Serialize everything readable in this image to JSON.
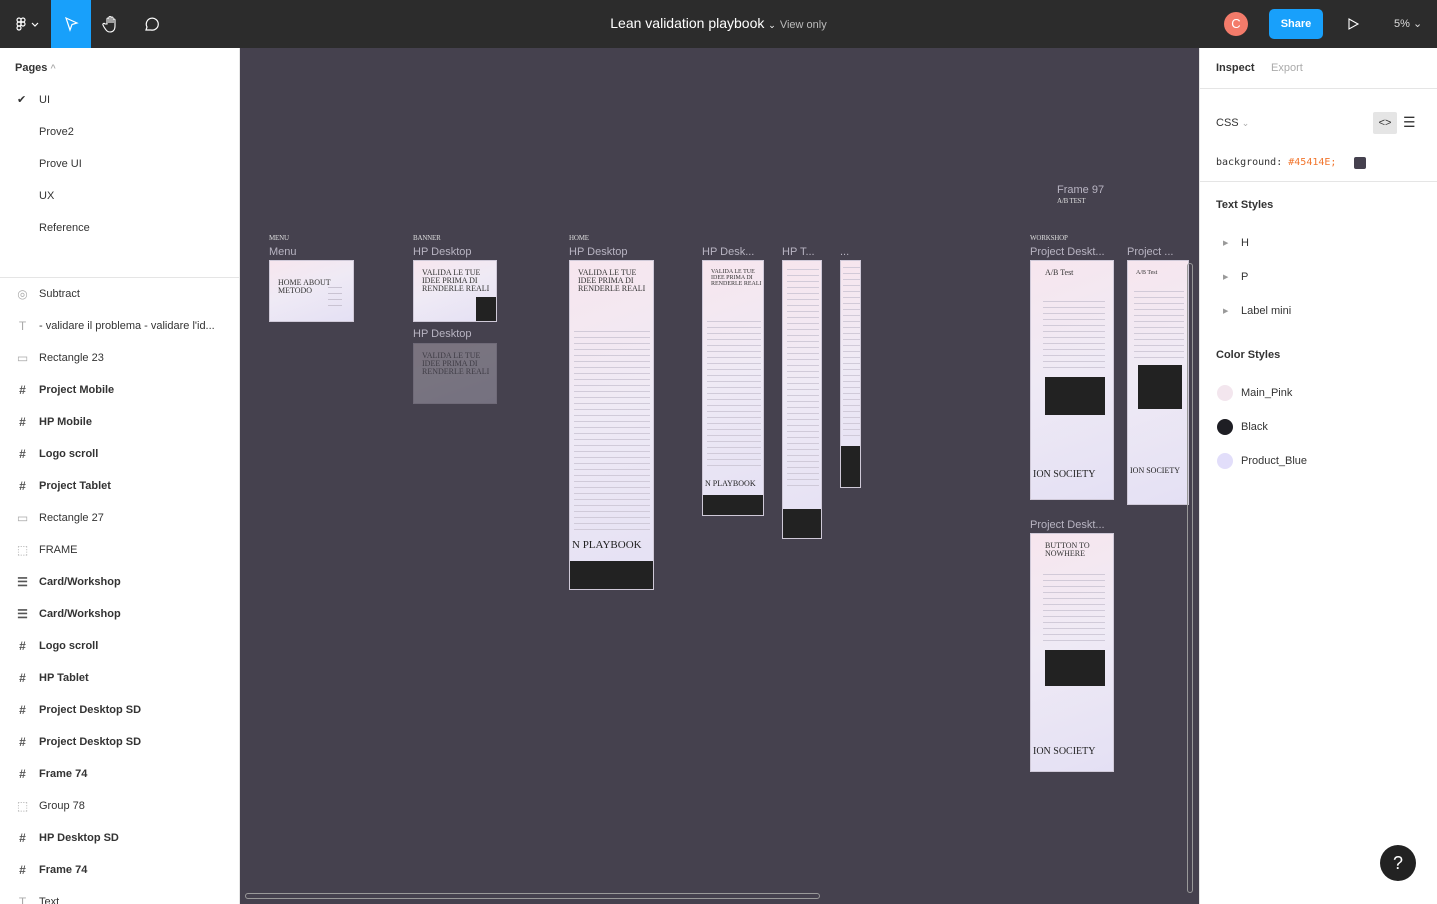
{
  "topbar": {
    "title": "Lean validation playbook",
    "view_mode": "View only",
    "avatar_initial": "C",
    "share_label": "Share",
    "zoom": "5%",
    "accent": "#18a0fb"
  },
  "pages": {
    "header": "Pages",
    "items": [
      {
        "label": "UI",
        "selected": true
      },
      {
        "label": "Prove2"
      },
      {
        "label": "Prove UI"
      },
      {
        "label": "UX"
      },
      {
        "label": "Reference"
      }
    ]
  },
  "layers": [
    {
      "label": "Subtract",
      "icon": "subtract-icon",
      "bold": false
    },
    {
      "label": "- validare il problema - validare l'id...",
      "icon": "text-icon",
      "bold": false
    },
    {
      "label": "Rectangle 23",
      "icon": "rectangle-icon",
      "bold": false
    },
    {
      "label": "Project Mobile",
      "icon": "frame-icon",
      "bold": true
    },
    {
      "label": "HP Mobile",
      "icon": "frame-icon",
      "bold": true
    },
    {
      "label": "Logo scroll",
      "icon": "frame-icon",
      "bold": true
    },
    {
      "label": "Project Tablet",
      "icon": "frame-icon",
      "bold": true
    },
    {
      "label": "Rectangle 27",
      "icon": "rectangle-icon",
      "bold": false
    },
    {
      "label": "FRAME",
      "icon": "group-icon",
      "bold": false
    },
    {
      "label": "Card/Workshop",
      "icon": "autolayout-icon",
      "bold": true
    },
    {
      "label": "Card/Workshop",
      "icon": "autolayout-icon",
      "bold": true
    },
    {
      "label": "Logo scroll",
      "icon": "frame-icon",
      "bold": true
    },
    {
      "label": "HP Tablet",
      "icon": "frame-icon",
      "bold": true
    },
    {
      "label": "Project Desktop SD",
      "icon": "frame-icon",
      "bold": true
    },
    {
      "label": "Project Desktop SD",
      "icon": "frame-icon",
      "bold": true
    },
    {
      "label": "Frame 74",
      "icon": "frame-icon",
      "bold": true
    },
    {
      "label": "Group 78",
      "icon": "group-icon",
      "bold": false
    },
    {
      "label": "HP Desktop SD",
      "icon": "frame-icon",
      "bold": true
    },
    {
      "label": "Frame 74",
      "icon": "frame-icon",
      "bold": true
    },
    {
      "label": "Text",
      "icon": "text-icon",
      "bold": false
    }
  ],
  "inspect": {
    "tabs": [
      "Inspect",
      "Export"
    ],
    "language": "CSS",
    "css_property": "background:",
    "css_value": "#45414E;",
    "bg_color": "#45414E",
    "text_styles_header": "Text Styles",
    "text_styles": [
      "H",
      "P",
      "Label mini"
    ],
    "color_styles_header": "Color Styles",
    "color_styles": [
      {
        "name": "Main_Pink",
        "color": "#f3e6ee"
      },
      {
        "name": "Black",
        "color": "#1e1e24"
      },
      {
        "name": "Product_Blue",
        "color": "#e2defa"
      }
    ]
  },
  "canvas": {
    "section_labels": [
      "MENU",
      "BANNER",
      "HOME",
      "WORKSHOP",
      "A/B TEST"
    ],
    "frames": [
      "Menu",
      "HP Desktop",
      "HP Desktop",
      "HP Desktop",
      "HP Desk...",
      "HP T...",
      "...",
      "Frame 97",
      "Project Deskt...",
      "Project ...",
      "Project Deskt..."
    ],
    "content": {
      "menu": "HOME ABOUT METODO",
      "hero": "VALIDA LE TUE IDEE PRIMA DI RENDERLE REALI",
      "playbook": "N PLAYBOOK",
      "ab": "A/B Test",
      "society": "ION SOCIETY",
      "button": "BUTTON TO NOWHERE"
    }
  },
  "help_label": "?"
}
